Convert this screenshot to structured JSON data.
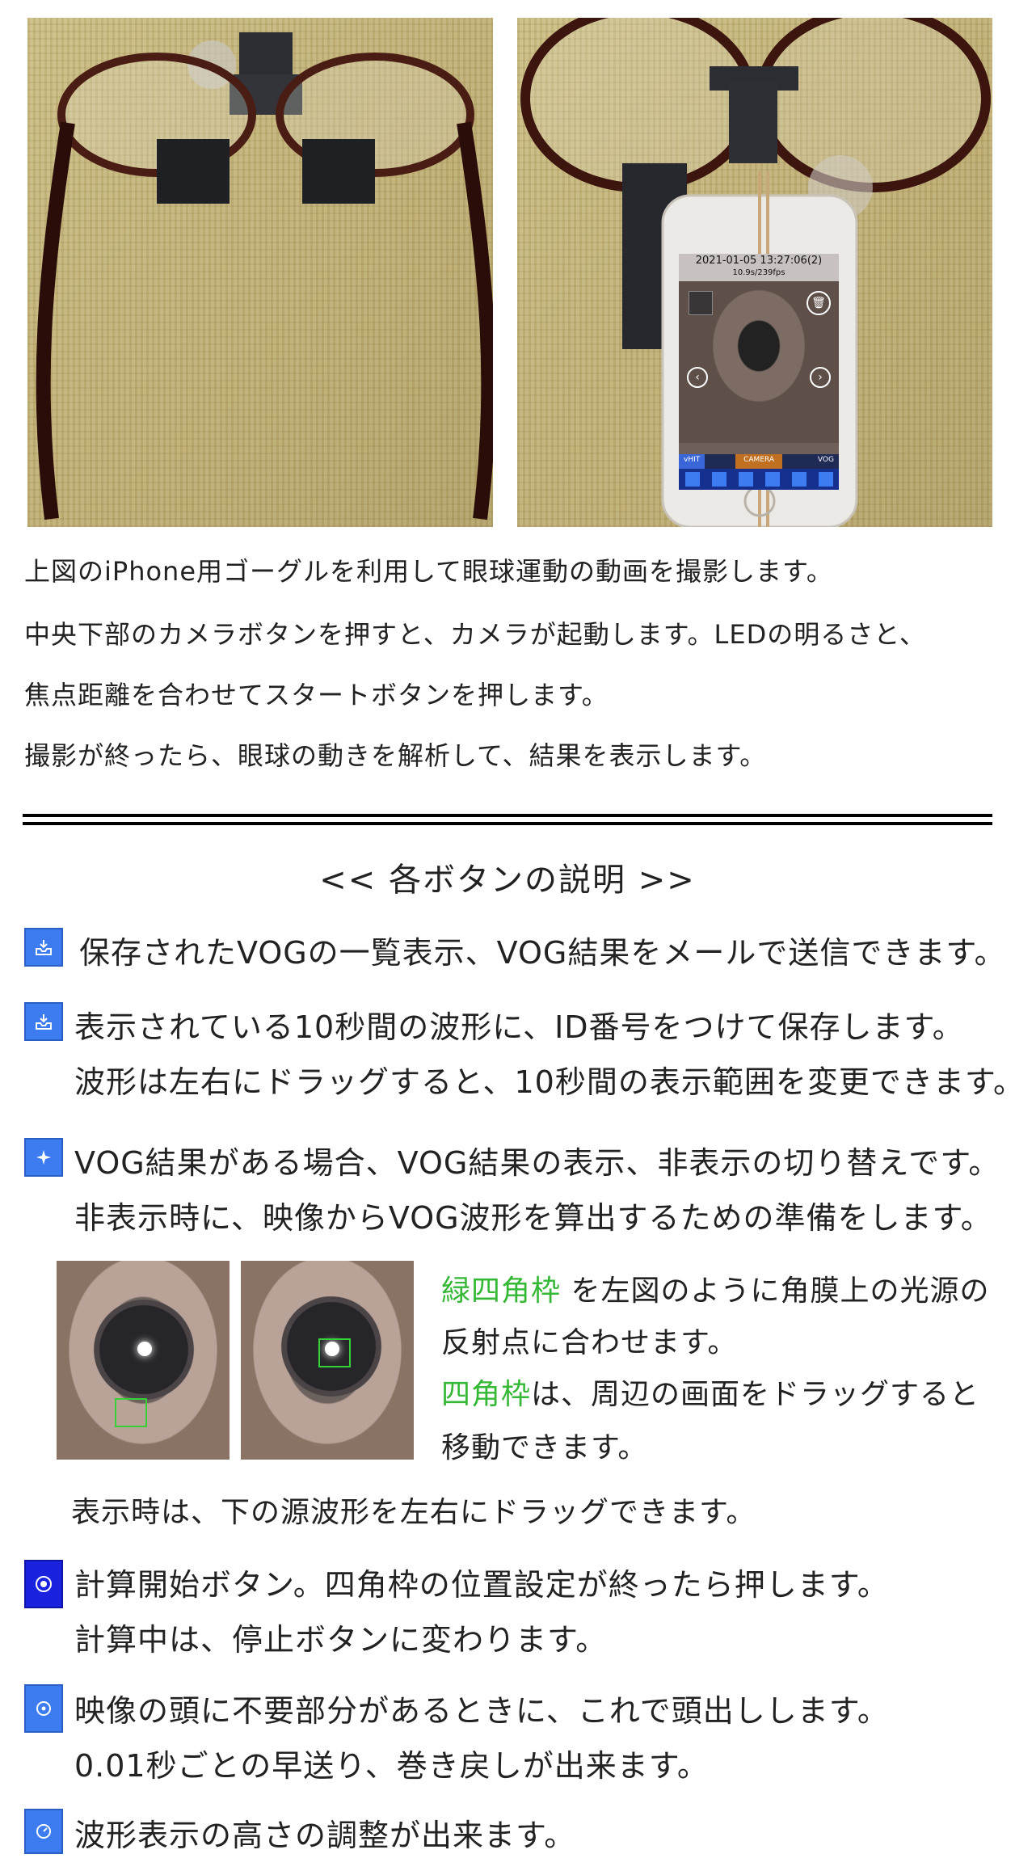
{
  "intro": {
    "line1": "上図のiPhone用ゴーグルを利用して眼球運動の動画を撮影します。",
    "line2": "中央下部のカメラボタンを押すと、カメラが起動します。LEDの明るさと、",
    "line3": "焦点距離を合わせてスタートボタンを押します。",
    "line4": "撮影が終ったら、眼球の動きを解析して、結果を表示します。"
  },
  "phone": {
    "datetime": "2021-01-05 13:27:06(2)",
    "fps": "10.9s/239fps",
    "tabs": [
      "vHIT",
      "CAMERA",
      "VOG"
    ]
  },
  "section": {
    "title": "<< 各ボタンの説明 >>"
  },
  "items": [
    {
      "icon": "inbox-icon",
      "lines": [
        "保存されたVOGの一覧表示、VOG結果をメールで送信できます。"
      ]
    },
    {
      "icon": "save-icon",
      "lines": [
        "表示されている10秒間の波形に、ID番号をつけて保存します。",
        "波形は左右にドラッグすると、10秒間の表示範囲を変更できます。"
      ]
    },
    {
      "icon": "sparkle-icon",
      "lines": [
        "VOG結果がある場合、VOG結果の表示、非表示の切り替えです。",
        "非表示時に、映像からVOG波形を算出するための準備をします。"
      ]
    },
    {
      "icon": "record-icon",
      "lines": [
        "計算開始ボタン。四角枠の位置設定が終ったら押します。",
        "計算中は、停止ボタンに変わります。"
      ]
    },
    {
      "icon": "target-icon",
      "lines": [
        "映像の頭に不要部分があるときに、これで頭出しします。",
        "0.01秒ごとの早送り、巻き戻しが出来ます。"
      ]
    },
    {
      "icon": "gauge-icon",
      "lines": [
        "波形表示の高さの調整が出来ます。"
      ]
    }
  ],
  "eye_note": {
    "green1": "緑四角枠",
    "rest1": " を左図のように角膜上の光源の",
    "line2": "反射点に合わせます。",
    "green2": "四角枠",
    "rest3": "は、周辺の画面をドラッグすると",
    "line4": "移動できます。"
  },
  "display_note": "表示時は、下の源波形を左右にドラッグできます。"
}
